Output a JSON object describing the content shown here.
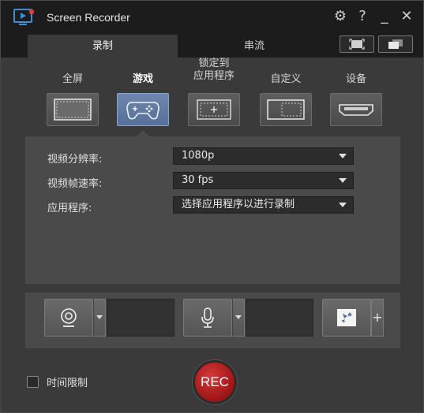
{
  "app": {
    "title": "Screen Recorder",
    "accent": "#55709a",
    "rec_color": "#b51e1e"
  },
  "tabs": [
    {
      "label": "录制",
      "active": true
    },
    {
      "label": "串流",
      "active": false
    }
  ],
  "title_icons": [
    "gear-icon",
    "help-icon",
    "minimize-icon",
    "close-icon"
  ],
  "capture_modes": [
    {
      "label": "全屏",
      "icon": "fullscreen-icon",
      "active": false
    },
    {
      "label": "游戏",
      "icon": "gamepad-icon",
      "active": true
    },
    {
      "label": "锁定到\n应用程序",
      "icon": "lock-app-icon",
      "active": false
    },
    {
      "label": "自定义",
      "icon": "custom-area-icon",
      "active": false
    },
    {
      "label": "设备",
      "icon": "device-hdmi-icon",
      "active": false
    }
  ],
  "settings": {
    "resolution": {
      "label": "视频分辨率:",
      "value": "1080p"
    },
    "framerate": {
      "label": "视频帧速率:",
      "value": "30 fps"
    },
    "application": {
      "label": "应用程序:",
      "value": "选择应用程序以进行录制"
    }
  },
  "devices": {
    "webcam_icon": "webcam-icon",
    "mic_icon": "microphone-icon",
    "effects_icon": "effects-icon",
    "add_label": "+"
  },
  "time_limit": {
    "label": "时间限制",
    "checked": false
  },
  "rec_label": "REC"
}
